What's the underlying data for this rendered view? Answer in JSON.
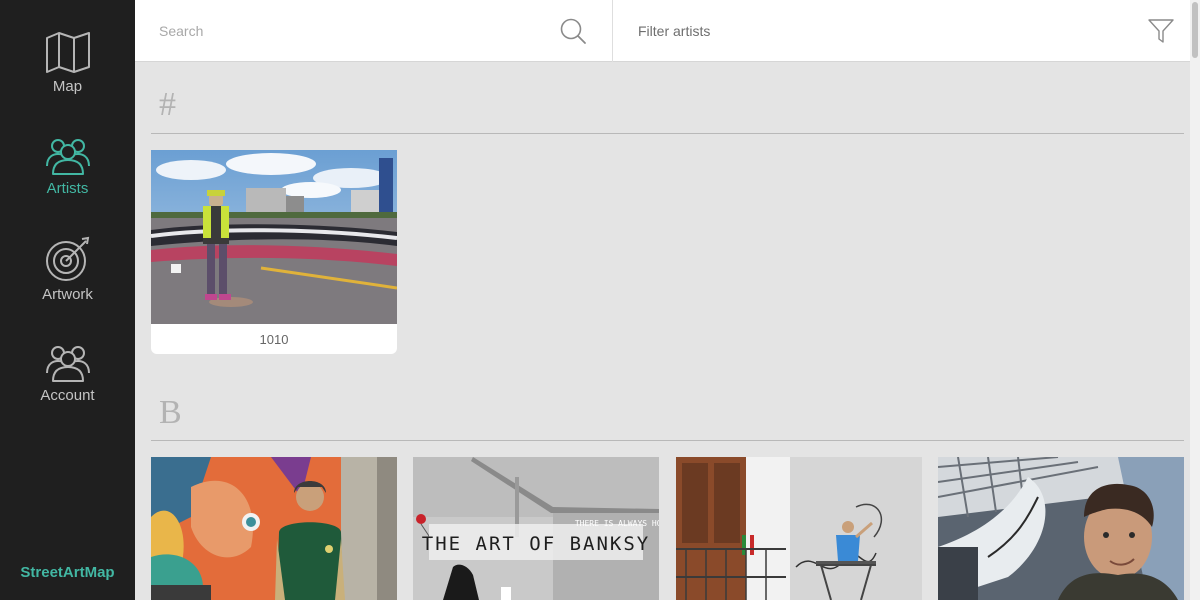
{
  "sidebar": {
    "items": [
      {
        "label": "Map",
        "icon": "map-icon"
      },
      {
        "label": "Artists",
        "icon": "artists-icon",
        "active": true
      },
      {
        "label": "Artwork",
        "icon": "target-icon"
      },
      {
        "label": "Account",
        "icon": "account-icon"
      }
    ],
    "brand": "StreetArtMap"
  },
  "search": {
    "placeholder": "Search",
    "icon": "search-icon"
  },
  "filter": {
    "placeholder": "Filter artists",
    "icon": "filter-icon"
  },
  "sections": [
    {
      "letter": "#",
      "artists": [
        {
          "name": "1010"
        }
      ]
    },
    {
      "letter": "B",
      "artists": [
        {
          "name": "",
          "photo_text": ""
        },
        {
          "name": "",
          "photo_text": "THE ART OF BANKSY",
          "photo_subtext": "THERE IS ALWAYS HOPE"
        },
        {
          "name": ""
        },
        {
          "name": ""
        }
      ]
    }
  ],
  "colors": {
    "accent": "#42b7a3",
    "sidebar_bg": "#1f1f1f",
    "content_bg": "#e4e4e4"
  }
}
